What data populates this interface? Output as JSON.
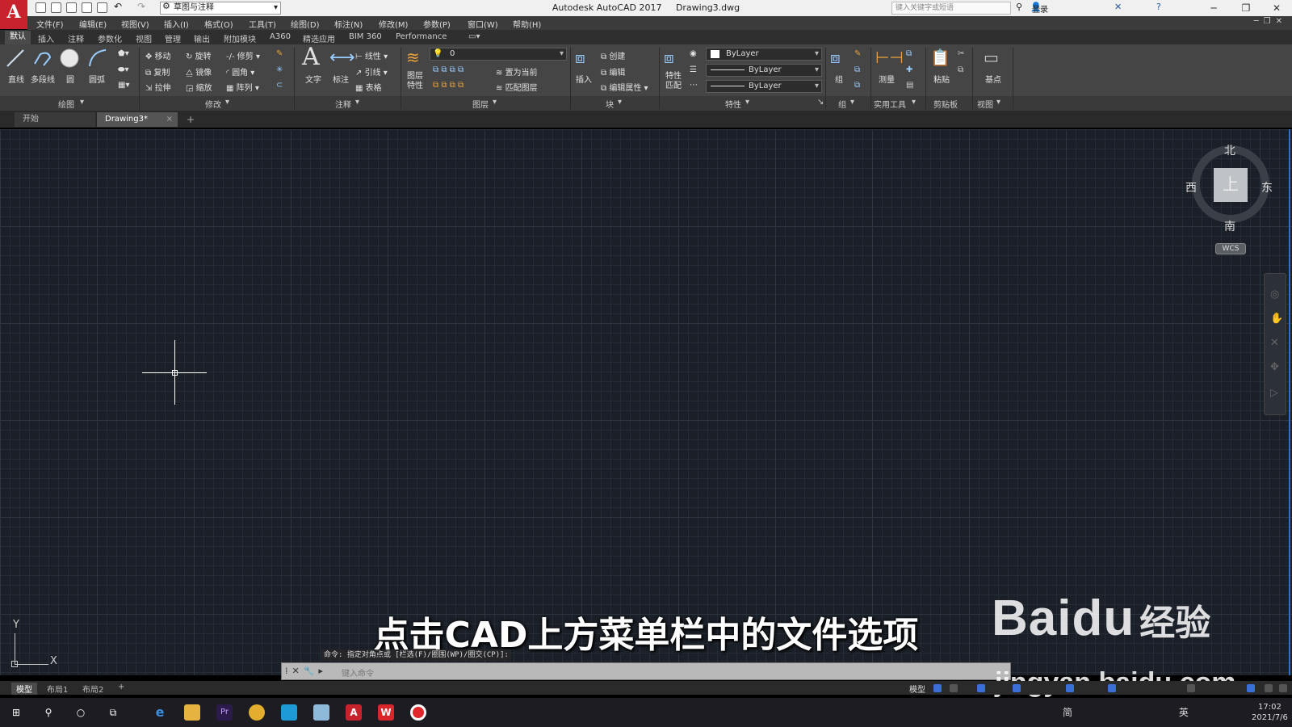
{
  "titlebar": {
    "workspace": "草图与注释",
    "app_name": "Autodesk AutoCAD 2017",
    "file_name": "Drawing3.dwg",
    "search_placeholder": "键入关键字或短语",
    "signin": "登录"
  },
  "menu": [
    "文件(F)",
    "编辑(E)",
    "视图(V)",
    "插入(I)",
    "格式(O)",
    "工具(T)",
    "绘图(D)",
    "标注(N)",
    "修改(M)",
    "参数(P)",
    "窗口(W)",
    "帮助(H)"
  ],
  "ribbon_tabs": [
    "默认",
    "插入",
    "注释",
    "参数化",
    "视图",
    "管理",
    "输出",
    "附加模块",
    "A360",
    "精选应用",
    "BIM 360",
    "Performance"
  ],
  "ribbon": {
    "draw": {
      "line": "直线",
      "polyline": "多段线",
      "circle": "圆",
      "arc": "圆弧",
      "title": "绘图"
    },
    "modify": {
      "move": "移动",
      "rotate": "旋转",
      "trim": "修剪",
      "copy": "复制",
      "mirror": "镜像",
      "fillet": "圆角",
      "stretch": "拉伸",
      "scale": "缩放",
      "array": "阵列",
      "title": "修改"
    },
    "annotation": {
      "text": "文字",
      "dimension": "标注",
      "linear": "线性",
      "leader": "引线",
      "table": "表格",
      "title": "注释"
    },
    "layers": {
      "properties": "图层\n特性",
      "current_layer": "0",
      "make_current": "置为当前",
      "match_layer": "匹配图层",
      "title": "图层"
    },
    "block": {
      "insert": "插入",
      "create": "创建",
      "edit": "编辑",
      "edit_attr": "编辑属性",
      "title": "块"
    },
    "properties": {
      "match": "特性\n匹配",
      "color": "ByLayer",
      "linetype": "ByLayer",
      "lineweight": "ByLayer",
      "title": "特性"
    },
    "groups": {
      "group": "组",
      "title": "组"
    },
    "utilities": {
      "measure": "测量",
      "title": "实用工具"
    },
    "clipboard": {
      "paste": "粘贴",
      "title": "剪贴板"
    },
    "view": {
      "base": "基点",
      "title": "视图"
    }
  },
  "doc_tabs": {
    "start": "开始",
    "drawing": "Drawing3*"
  },
  "viewcube": {
    "north": "北",
    "south": "南",
    "east": "东",
    "west": "西",
    "face": "上",
    "wcs": "WCS"
  },
  "ucs": {
    "x": "X",
    "y": "Y"
  },
  "command": {
    "history": "命令: 指定对角点或 [栏选(F)/圈围(WP)/圈交(CP)]:",
    "placeholder": "键入命令"
  },
  "caption": "点击CAD上方菜单栏中的文件选项",
  "watermark": {
    "brand": "Baidu",
    "jingyan": "经验",
    "url": "jingyan.baidu.com"
  },
  "layout_tabs": [
    "模型",
    "布局1",
    "布局2"
  ],
  "status": {
    "model": "模型"
  },
  "tray": {
    "ime": "简",
    "lang": "英"
  },
  "clock": {
    "time": "17:02",
    "date": "2021/7/6"
  }
}
